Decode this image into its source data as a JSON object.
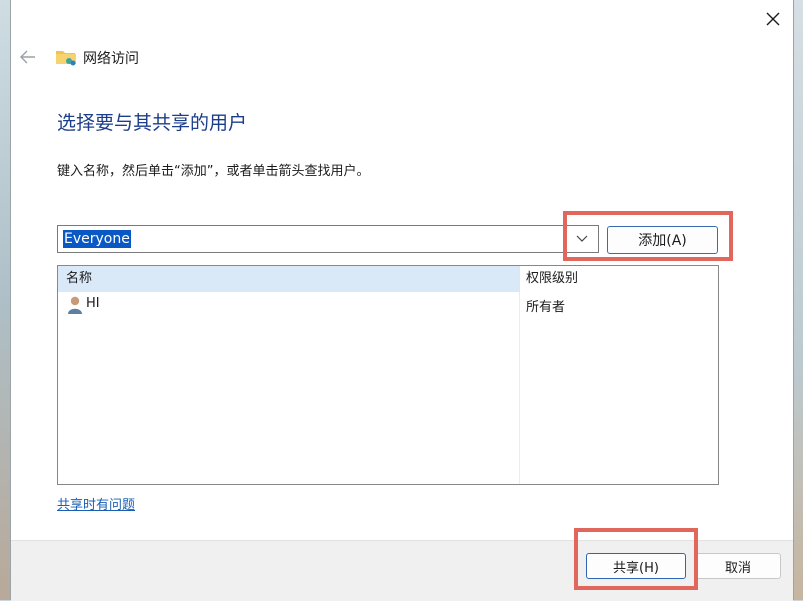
{
  "window": {
    "title": "网络访问",
    "icon": "shared-folder-icon"
  },
  "page": {
    "heading": "选择要与其共享的用户",
    "instruction": "键入名称，然后单击“添加”，或者单击箭头查找用户。"
  },
  "input": {
    "value": "Everyone",
    "dropdown_icon": "chevron-down-icon"
  },
  "buttons": {
    "add": "添加(A)",
    "share": "共享(H)",
    "cancel": "取消"
  },
  "table": {
    "columns": [
      "名称",
      "权限级别"
    ],
    "rows": [
      {
        "name": "HI",
        "permission": "所有者",
        "icon": "user-icon"
      }
    ]
  },
  "help_link": "共享时有问题",
  "colors": {
    "accent": "#1c3e8a",
    "selection": "#0a58c4",
    "highlight_annotation": "#e1675d",
    "header_row": "#d9e9f8"
  }
}
